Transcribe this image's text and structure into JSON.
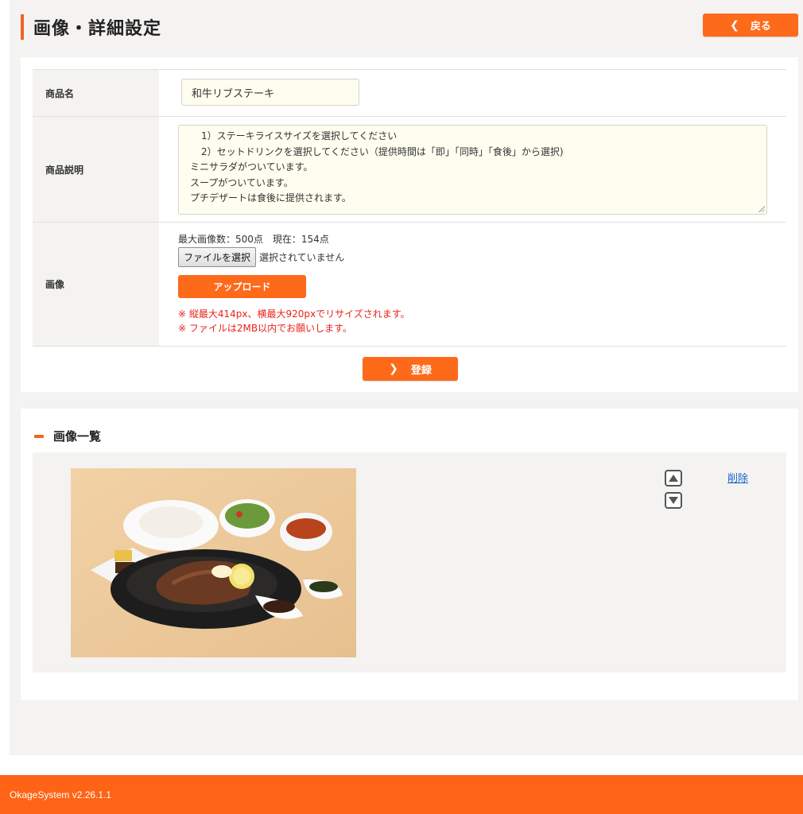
{
  "header": {
    "title": "画像・詳細設定",
    "back_label": "戻る"
  },
  "form": {
    "name_label": "商品名",
    "name_value": "和牛リブステーキ",
    "desc_label": "商品説明",
    "desc_lines": [
      "1）ステーキライスサイズを選択してください",
      "2）セットドリンクを選択してください（提供時間は「即」「同時」「食後」から選択)",
      "ミニサラダがついています。",
      "スープがついています。",
      "プチデザートは食後に提供されます。"
    ],
    "image_label": "画像",
    "image_info": "最大画像数：500点　現在：154点",
    "file_button": "ファイルを選択",
    "file_status": "選択されていません",
    "upload_label": "アップロード",
    "notes": [
      "※ 縦最大414px、横最大920pxでリサイズされます。",
      "※ ファイルは2MB以内でお願いします。"
    ],
    "register_label": "登録"
  },
  "image_list": {
    "title": "画像一覧",
    "items": [
      {
        "delete_label": "削除",
        "image_icon": "steak-set-photo"
      }
    ]
  },
  "footer": {
    "version": "OkageSystem v2.26.1.1"
  },
  "colors": {
    "accent": "#fd6a1a",
    "footer": "#ff6316",
    "note_red": "#e8241b",
    "link": "#1a63c7"
  }
}
